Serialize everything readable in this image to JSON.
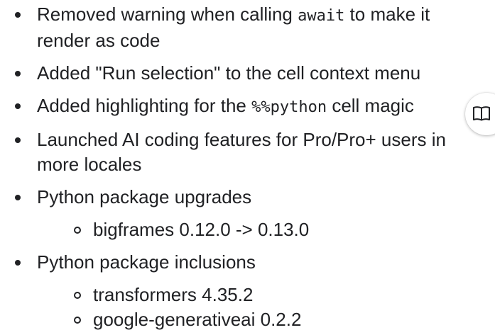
{
  "release_notes": {
    "items": [
      {
        "line1_before": "Removed warning when calling ",
        "line1_code": "await",
        "line1_after": " to make it",
        "line2": "render as code"
      },
      {
        "text": "Added \"Run selection\" to the cell context menu"
      },
      {
        "before": "Added highlighting for the ",
        "code": "%%python",
        "after": " cell magic"
      },
      {
        "line1": "Launched AI coding features for Pro/Pro+ users in",
        "line2": "more locales"
      },
      {
        "text": "Python package upgrades",
        "subitems": [
          "bigframes 0.12.0 -> 0.13.0"
        ]
      },
      {
        "text": "Python package inclusions",
        "subitems": [
          "transformers 4.35.2",
          "google-generativeai 0.2.2"
        ]
      }
    ]
  },
  "floating_button": {
    "icon": "book-open-icon"
  }
}
